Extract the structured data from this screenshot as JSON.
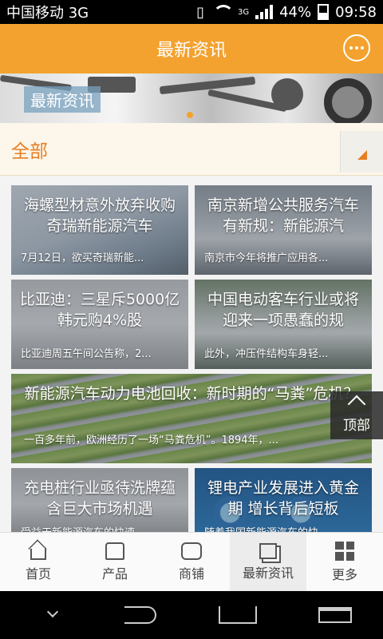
{
  "status_bar": {
    "carrier": "中国移动 3G",
    "network_badge": "3G",
    "battery": "44%",
    "time": "09:58"
  },
  "header": {
    "title": "最新资讯",
    "chat_icon": "chat-bubble-icon"
  },
  "banner": {
    "title": "最新资讯",
    "active_dot": 1,
    "dot_count": 1
  },
  "category": {
    "label": "全部",
    "toggle_icon": "triangle-dropdown-icon"
  },
  "news": [
    {
      "title": "海螺型材意外放弃收购奇瑞新能源汽车",
      "summary": "7月12日，欲买奇瑞新能..."
    },
    {
      "title": "南京新增公共服务汽车有新规：新能源汽",
      "summary": "南京市今年将推广应用各..."
    },
    {
      "title": "比亚迪：三星斥5000亿韩元购4%股",
      "summary": "比亚迪周五午间公告称，2..."
    },
    {
      "title": "中国电动客车行业或将迎来一项愚蠢的规",
      "summary": "此外，冲压件结构车身轻..."
    },
    {
      "title": "新能源汽车动力电池回收：新时期的“马粪”危机？",
      "summary": "一百多年前，欧洲经历了一场“马粪危机”。1894年，..."
    },
    {
      "title": "充电桩行业亟待洗牌蕴含巨大市场机遇",
      "summary": "受益于新能源汽车的快速..."
    },
    {
      "title": "锂电产业发展进入黄金期 增长背后短板",
      "summary": "随着我国新能源汽车的快..."
    }
  ],
  "back_to_top": {
    "label": "顶部"
  },
  "bottom_nav": [
    {
      "label": "首页",
      "icon": "home-icon"
    },
    {
      "label": "产品",
      "icon": "shirt-icon"
    },
    {
      "label": "商铺",
      "icon": "shop-icon"
    },
    {
      "label": "最新资讯",
      "icon": "news-icon",
      "active": true
    },
    {
      "label": "更多",
      "icon": "grid-more-icon"
    }
  ],
  "colors": {
    "accent": "#f3a230",
    "category_text": "#e67e22"
  }
}
